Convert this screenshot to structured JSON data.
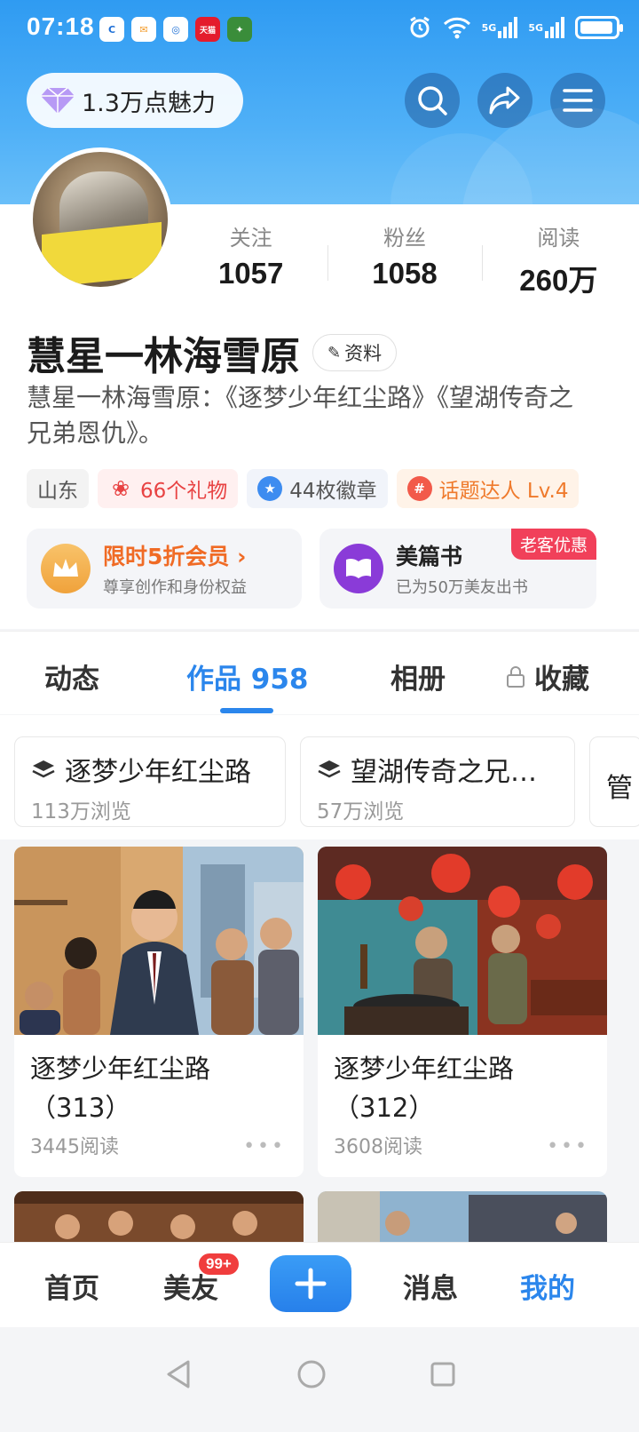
{
  "status_bar": {
    "time": "07:18",
    "app_icons": [
      "c-app-icon",
      "mail-app-icon",
      "browser-app-icon",
      "tmall-app-icon",
      "game-app-icon"
    ],
    "tmall_label": "天猫",
    "signal_label": "5G"
  },
  "header": {
    "charm_text": "1.3万点魅力"
  },
  "profile": {
    "stats": [
      {
        "label": "关注",
        "value": "1057"
      },
      {
        "label": "粉丝",
        "value": "1058"
      },
      {
        "label": "阅读",
        "value": "260万"
      }
    ],
    "name": "慧星一林海雪原",
    "info_button": "资料",
    "bio": "慧星一林海雪原：《逐梦少年红尘路》《望湖传奇之兄弟恩仇》。",
    "tags": {
      "location": "山东",
      "gifts": "66个礼物",
      "badges": "44枚徽章",
      "topic": "话题达人 Lv.4"
    },
    "promo_vip": {
      "title": "限时5折会员 ›",
      "subtitle": "尊享创作和身份权益"
    },
    "promo_book": {
      "title": "美篇书",
      "subtitle": "已为50万美友出书",
      "corner": "老客优惠"
    }
  },
  "tabs": [
    {
      "label": "动态"
    },
    {
      "label": "作品 958"
    },
    {
      "label": "相册"
    },
    {
      "label": "收藏"
    }
  ],
  "collections": [
    {
      "title": "逐梦少年红尘路",
      "views": "113万浏览"
    },
    {
      "title": "望湖传奇之兄…",
      "views": "57万浏览"
    },
    {
      "title": "管"
    }
  ],
  "works": [
    {
      "title": "逐梦少年红尘路（313）",
      "reads": "3445阅读"
    },
    {
      "title": "逐梦少年红尘路（312）",
      "reads": "3608阅读"
    }
  ],
  "bottom_nav": {
    "home": "首页",
    "friends": "美友",
    "friends_badge": "99+",
    "messages": "消息",
    "mine": "我的"
  },
  "colors": {
    "accent": "#2b86ec",
    "header_top": "#2f9bf2",
    "vip_orange": "#f06b25",
    "badge_red": "#f03d3d"
  }
}
